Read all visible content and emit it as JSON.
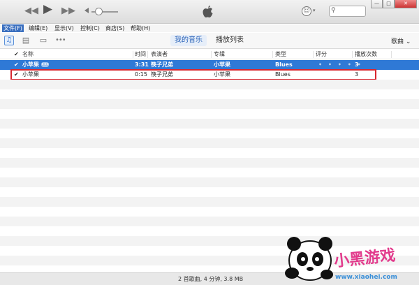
{
  "player": {
    "rewind_glyph": "◀◀",
    "play_glyph": "▶",
    "forward_glyph": "▶▶",
    "account_glyph": "☺",
    "caret_glyph": "▾",
    "search_glyph": "⚲",
    "search_placeholder": "",
    "win_min": "—",
    "win_max": "□",
    "win_close": "✕"
  },
  "menu": [
    {
      "label": "文件(F)",
      "active": true
    },
    {
      "label": "编辑(E)"
    },
    {
      "label": "显示(V)"
    },
    {
      "label": "控制(C)"
    },
    {
      "label": "商店(S)"
    },
    {
      "label": "帮助(H)"
    }
  ],
  "toolbar": {
    "music_glyph": "♫",
    "film_glyph": "▤",
    "tv_glyph": "▭",
    "more_glyph": "•••",
    "tabs": [
      "我的音乐",
      "播放列表"
    ],
    "active_tab": "我的音乐",
    "view_select": "歌曲 ⌄"
  },
  "columns": {
    "check": "✔",
    "name": "名称",
    "time": "时间",
    "artist": "表演者",
    "album": "专辑",
    "genre": "类型",
    "rating": "评分",
    "plays": "播放次数"
  },
  "rows": [
    {
      "check": "✔",
      "name": "小苹果",
      "ellipsis": "•••",
      "time": "3:31",
      "artist": "筷子兄弟",
      "album": "小苹果",
      "genre": "Blues",
      "rating": "• • • • •",
      "plays": "3"
    },
    {
      "check": "✔",
      "name": "小苹果",
      "time": "0:15",
      "artist": "筷子兄弟",
      "album": "小苹果",
      "genre": "Blues",
      "rating": "",
      "plays": "3"
    }
  ],
  "status": "2 首歌曲, 4 分钟, 3.8 MB",
  "watermark": {
    "text": "小黑游戏",
    "url": "www.xiaohei.com"
  },
  "colors": {
    "selection": "#2f79d6",
    "outline": "#d8262e",
    "accent": "#2a62b8"
  }
}
